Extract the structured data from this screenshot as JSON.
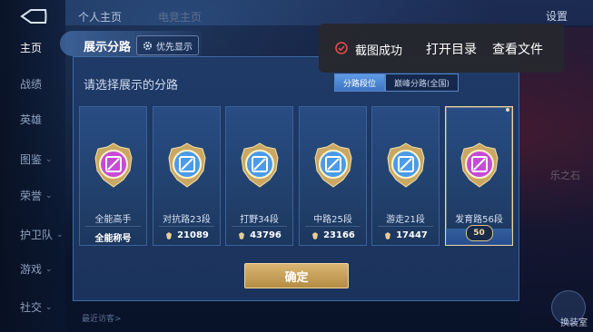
{
  "sidebar": {
    "items": [
      {
        "label": "主页",
        "active": true,
        "chevron": false
      },
      {
        "label": "战绩",
        "active": false,
        "chevron": false
      },
      {
        "label": "英雄",
        "active": false,
        "chevron": false
      },
      {
        "label": "图鉴",
        "active": false,
        "chevron": true
      },
      {
        "label": "荣誉",
        "active": false,
        "chevron": true
      },
      {
        "label": "护卫队",
        "active": false,
        "chevron": true
      },
      {
        "label": "游戏",
        "active": false,
        "chevron": true
      },
      {
        "label": "社交",
        "active": false,
        "chevron": true
      }
    ]
  },
  "topbar": {
    "tab1": "个人主页",
    "tab2": "电竞主页",
    "settings": "设置"
  },
  "panel": {
    "title": "展示分路",
    "priority_label": "优先显示",
    "prompt": "请选择展示的分路",
    "tabs": [
      {
        "label": "分路段位",
        "active": true
      },
      {
        "label": "巅峰分路(全国)",
        "active": false
      }
    ],
    "cards": [
      {
        "name": "全能高手",
        "score": "全能称号",
        "score_icon": false,
        "emblem": "all-round-icon",
        "color": "#c64bd6",
        "selected": false
      },
      {
        "name": "对抗路23段",
        "score": "21089",
        "score_icon": true,
        "emblem": "clash-lane-icon",
        "color": "#4a9be8",
        "selected": false
      },
      {
        "name": "打野34段",
        "score": "43796",
        "score_icon": true,
        "emblem": "jungle-icon",
        "color": "#4a9be8",
        "selected": false
      },
      {
        "name": "中路25段",
        "score": "23166",
        "score_icon": true,
        "emblem": "mid-lane-icon",
        "color": "#4a9be8",
        "selected": false
      },
      {
        "name": "游走21段",
        "score": "17447",
        "score_icon": true,
        "emblem": "roam-icon",
        "color": "#4a9be8",
        "selected": false
      },
      {
        "name": "发育路56段",
        "score": "50",
        "score_icon": false,
        "emblem": "farm-lane-icon",
        "color": "#c64bd6",
        "selected": true
      }
    ],
    "confirm_label": "确定"
  },
  "toast": {
    "message": "截图成功",
    "open_dir": "打开目录",
    "view_file": "查看文件"
  },
  "right_text": "乐之石",
  "corner_label": "换装室",
  "bottom_hint": "最近访客>"
}
